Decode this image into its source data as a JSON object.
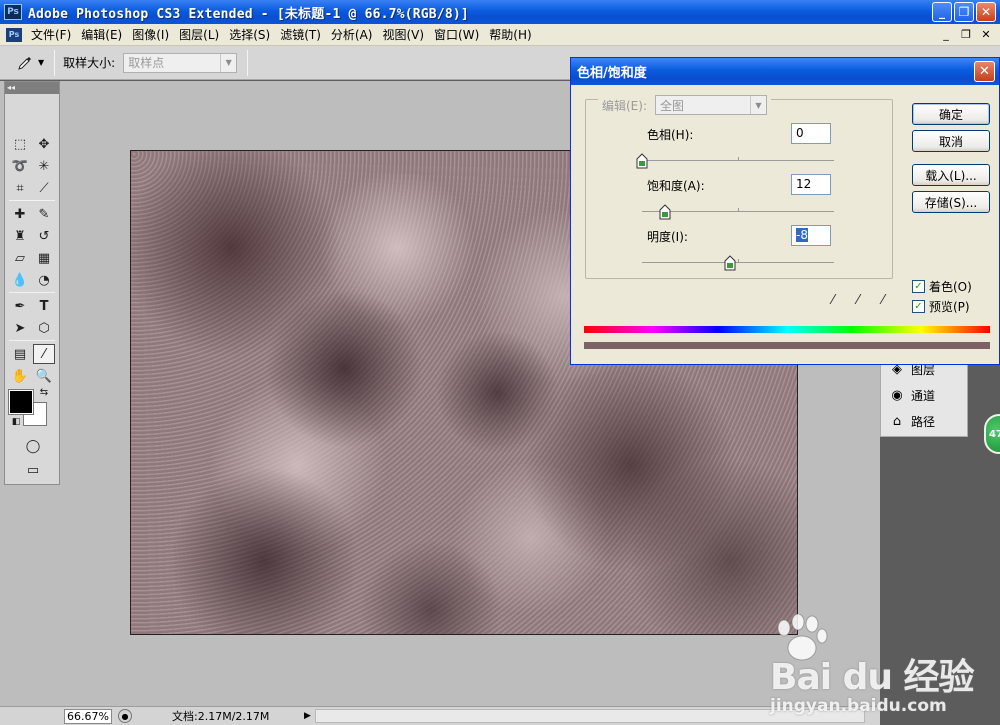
{
  "window": {
    "app_icon": "Ps",
    "title": "Adobe Photoshop CS3 Extended - [未标题-1 @ 66.7%(RGB/8)]",
    "controls": [
      "_",
      "❐",
      "✕"
    ]
  },
  "menubar": {
    "doc_icon": "Ps",
    "items": [
      "文件(F)",
      "编辑(E)",
      "图像(I)",
      "图层(L)",
      "选择(S)",
      "滤镜(T)",
      "分析(A)",
      "视图(V)",
      "窗口(W)",
      "帮助(H)"
    ],
    "mdi_controls": [
      "_",
      "❐",
      "✕"
    ]
  },
  "options_bar": {
    "tool_icon": "eyedropper-icon",
    "sample_size_label": "取样大小:",
    "sample_size_value": "取样点"
  },
  "statusbar": {
    "zoom": "66.67%",
    "doc_info": "文档:2.17M/2.17M"
  },
  "panels": {
    "items": [
      {
        "label": "图层",
        "icon": "layers-icon"
      },
      {
        "label": "通道",
        "icon": "channels-icon"
      },
      {
        "label": "路径",
        "icon": "paths-icon"
      }
    ],
    "badge": "47"
  },
  "dialog": {
    "title": "色相/饱和度",
    "edit_label": "编辑(E):",
    "edit_value": "全图",
    "hue_label": "色相(H):",
    "hue_value": "0",
    "hue_level": 0,
    "saturation_label": "饱和度(A):",
    "saturation_value": "12",
    "saturation_level": 12,
    "lightness_label": "明度(I):",
    "lightness_value": "-8",
    "lightness_level": -8,
    "buttons": {
      "ok": "确定",
      "cancel": "取消",
      "load": "载入(L)...",
      "save": "存储(S)..."
    },
    "colorize_label": "着色(O)",
    "colorize_checked": true,
    "preview_label": "预览(P)",
    "preview_checked": true,
    "result_color": "#7c6264"
  },
  "watermark": {
    "brand": "Bai du 经验",
    "url": "jingyan.baidu.com"
  }
}
